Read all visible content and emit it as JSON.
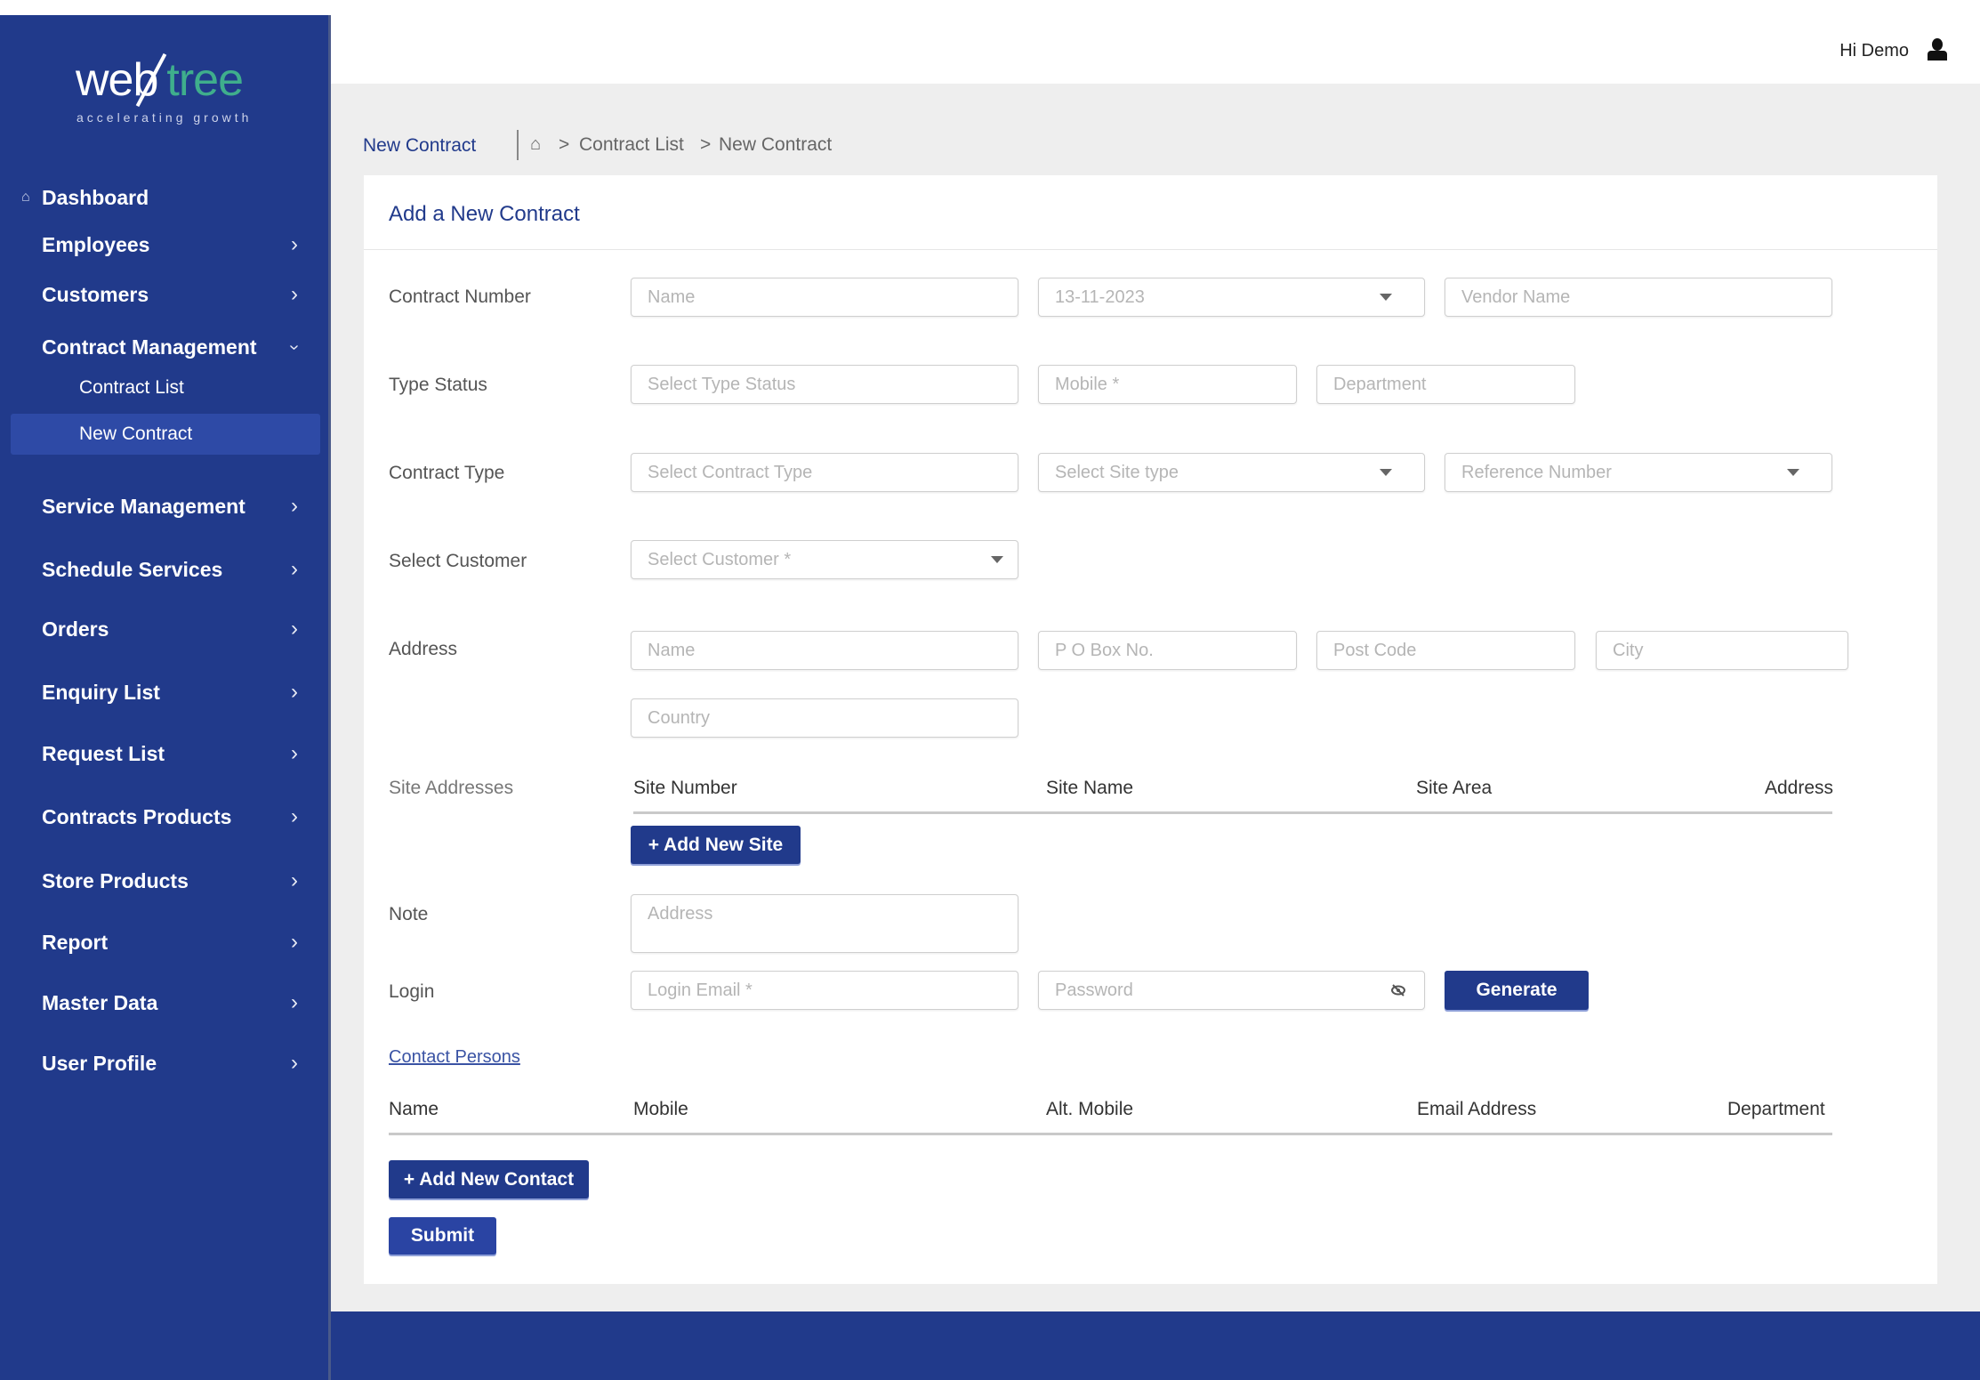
{
  "brand": {
    "name_part1": "web",
    "name_part2": "tree",
    "tagline": "accelerating growth"
  },
  "header": {
    "greeting": "Hi Demo",
    "user_icon": "user-icon"
  },
  "sidebar": {
    "items": [
      {
        "label": "Dashboard",
        "icon": "home-icon"
      },
      {
        "label": "Employees",
        "icon": "chevron-right-icon"
      },
      {
        "label": "Customers",
        "icon": "chevron-right-icon"
      },
      {
        "label": "Contract Management",
        "icon": "chevron-down-icon",
        "expanded": true,
        "children": [
          {
            "label": "Contract List",
            "active": false
          },
          {
            "label": "New Contract",
            "active": true
          }
        ]
      },
      {
        "label": "Service Management",
        "icon": "chevron-right-icon"
      },
      {
        "label": "Schedule Services",
        "icon": "chevron-right-icon"
      },
      {
        "label": "Orders",
        "icon": "chevron-right-icon"
      },
      {
        "label": "Enquiry List",
        "icon": "chevron-right-icon"
      },
      {
        "label": "Request List",
        "icon": "chevron-right-icon"
      },
      {
        "label": "Contracts Products",
        "icon": "chevron-right-icon"
      },
      {
        "label": "Store Products",
        "icon": "chevron-right-icon"
      },
      {
        "label": "Report",
        "icon": "chevron-right-icon"
      },
      {
        "label": "Master Data",
        "icon": "chevron-right-icon"
      },
      {
        "label": "User Profile",
        "icon": "chevron-right-icon"
      }
    ]
  },
  "breadcrumb": {
    "page_title": "New Contract",
    "items": [
      "Contract List",
      "New Contract"
    ],
    "separator": ">"
  },
  "form": {
    "title": "Add a New Contract",
    "labels": {
      "contract_number": "Contract Number",
      "type_status": "Type Status",
      "contract_type": "Contract Type",
      "select_customer": "Select Customer",
      "address": "Address",
      "site_addresses": "Site Addresses",
      "note": "Note",
      "login": "Login"
    },
    "fields": {
      "name": {
        "placeholder": "Name",
        "value": ""
      },
      "date": {
        "value": "13-11-2023"
      },
      "vendor_name": {
        "placeholder": "Vendor Name"
      },
      "type_status": {
        "placeholder": "Select Type Status"
      },
      "mobile": {
        "placeholder": "Mobile *"
      },
      "department": {
        "placeholder": "Department"
      },
      "contract_type": {
        "placeholder": "Select Contract Type"
      },
      "site_type": {
        "placeholder": "Select Site type"
      },
      "reference_number": {
        "placeholder": "Reference Number"
      },
      "customer": {
        "placeholder": "Select Customer *"
      },
      "address_name": {
        "placeholder": "Name"
      },
      "po_box": {
        "placeholder": "P O Box No."
      },
      "post_code": {
        "placeholder": "Post Code"
      },
      "city": {
        "placeholder": "City"
      },
      "country": {
        "placeholder": "Country"
      },
      "note": {
        "placeholder": "Address"
      },
      "login_email": {
        "placeholder": "Login Email *"
      },
      "password": {
        "placeholder": "Password"
      }
    },
    "site_table": {
      "columns": [
        "Site Number",
        "Site Name",
        "Site Area",
        "Address"
      ],
      "rows": []
    },
    "buttons": {
      "add_site": "+ Add New Site",
      "generate": "Generate",
      "add_contact": "+ Add New Contact",
      "submit": "Submit"
    },
    "contact_persons_link": "Contact Persons",
    "contact_table": {
      "columns": [
        "Name",
        "Mobile",
        "Alt. Mobile",
        "Email Address",
        "Department"
      ],
      "rows": []
    }
  },
  "colors": {
    "primary": "#213a8b",
    "active_item": "#2e4aa6",
    "page_bg": "#eeeeee",
    "logo_green": "#3fae8c",
    "logo_blue": "#4aa3d8"
  }
}
